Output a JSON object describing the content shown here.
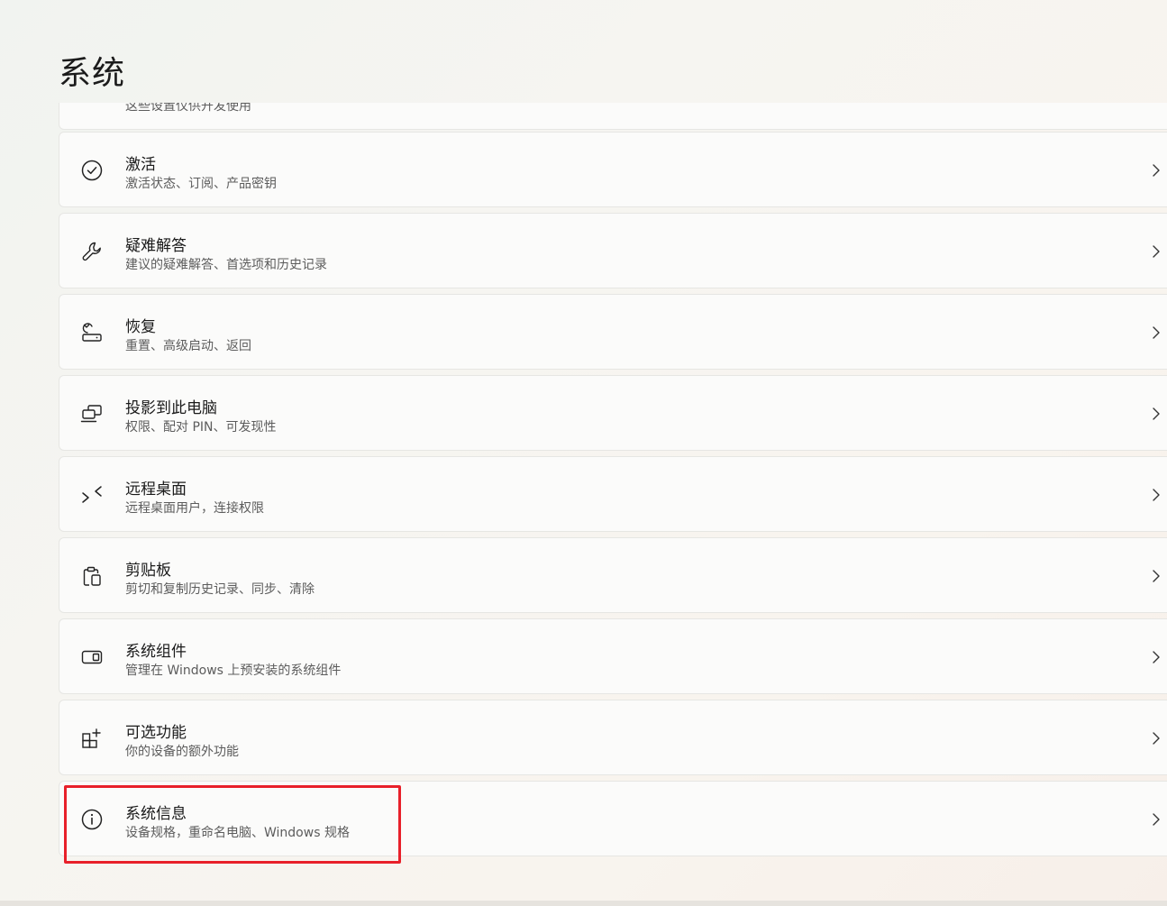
{
  "page": {
    "title": "系统"
  },
  "items": [
    {
      "icon": "developer-icon",
      "title": "",
      "subtitle": "这些设置仅供开发使用"
    },
    {
      "icon": "check-circle-icon",
      "title": "激活",
      "subtitle": "激活状态、订阅、产品密钥"
    },
    {
      "icon": "wrench-icon",
      "title": "疑难解答",
      "subtitle": "建议的疑难解答、首选项和历史记录"
    },
    {
      "icon": "recovery-icon",
      "title": "恢复",
      "subtitle": "重置、高级启动、返回"
    },
    {
      "icon": "project-to-pc-icon",
      "title": "投影到此电脑",
      "subtitle": "权限、配对 PIN、可发现性"
    },
    {
      "icon": "remote-desktop-icon",
      "title": "远程桌面",
      "subtitle": "远程桌面用户，连接权限"
    },
    {
      "icon": "clipboard-icon",
      "title": "剪贴板",
      "subtitle": "剪切和复制历史记录、同步、清除"
    },
    {
      "icon": "system-components-icon",
      "title": "系统组件",
      "subtitle": "管理在 Windows 上预安装的系统组件"
    },
    {
      "icon": "optional-features-icon",
      "title": "可选功能",
      "subtitle": "你的设备的额外功能"
    },
    {
      "icon": "info-icon",
      "title": "系统信息",
      "subtitle": "设备规格，重命名电脑、Windows 规格"
    }
  ],
  "annotation": {
    "highlight_color": "#e8202a",
    "highlighted_item": "系统信息"
  }
}
